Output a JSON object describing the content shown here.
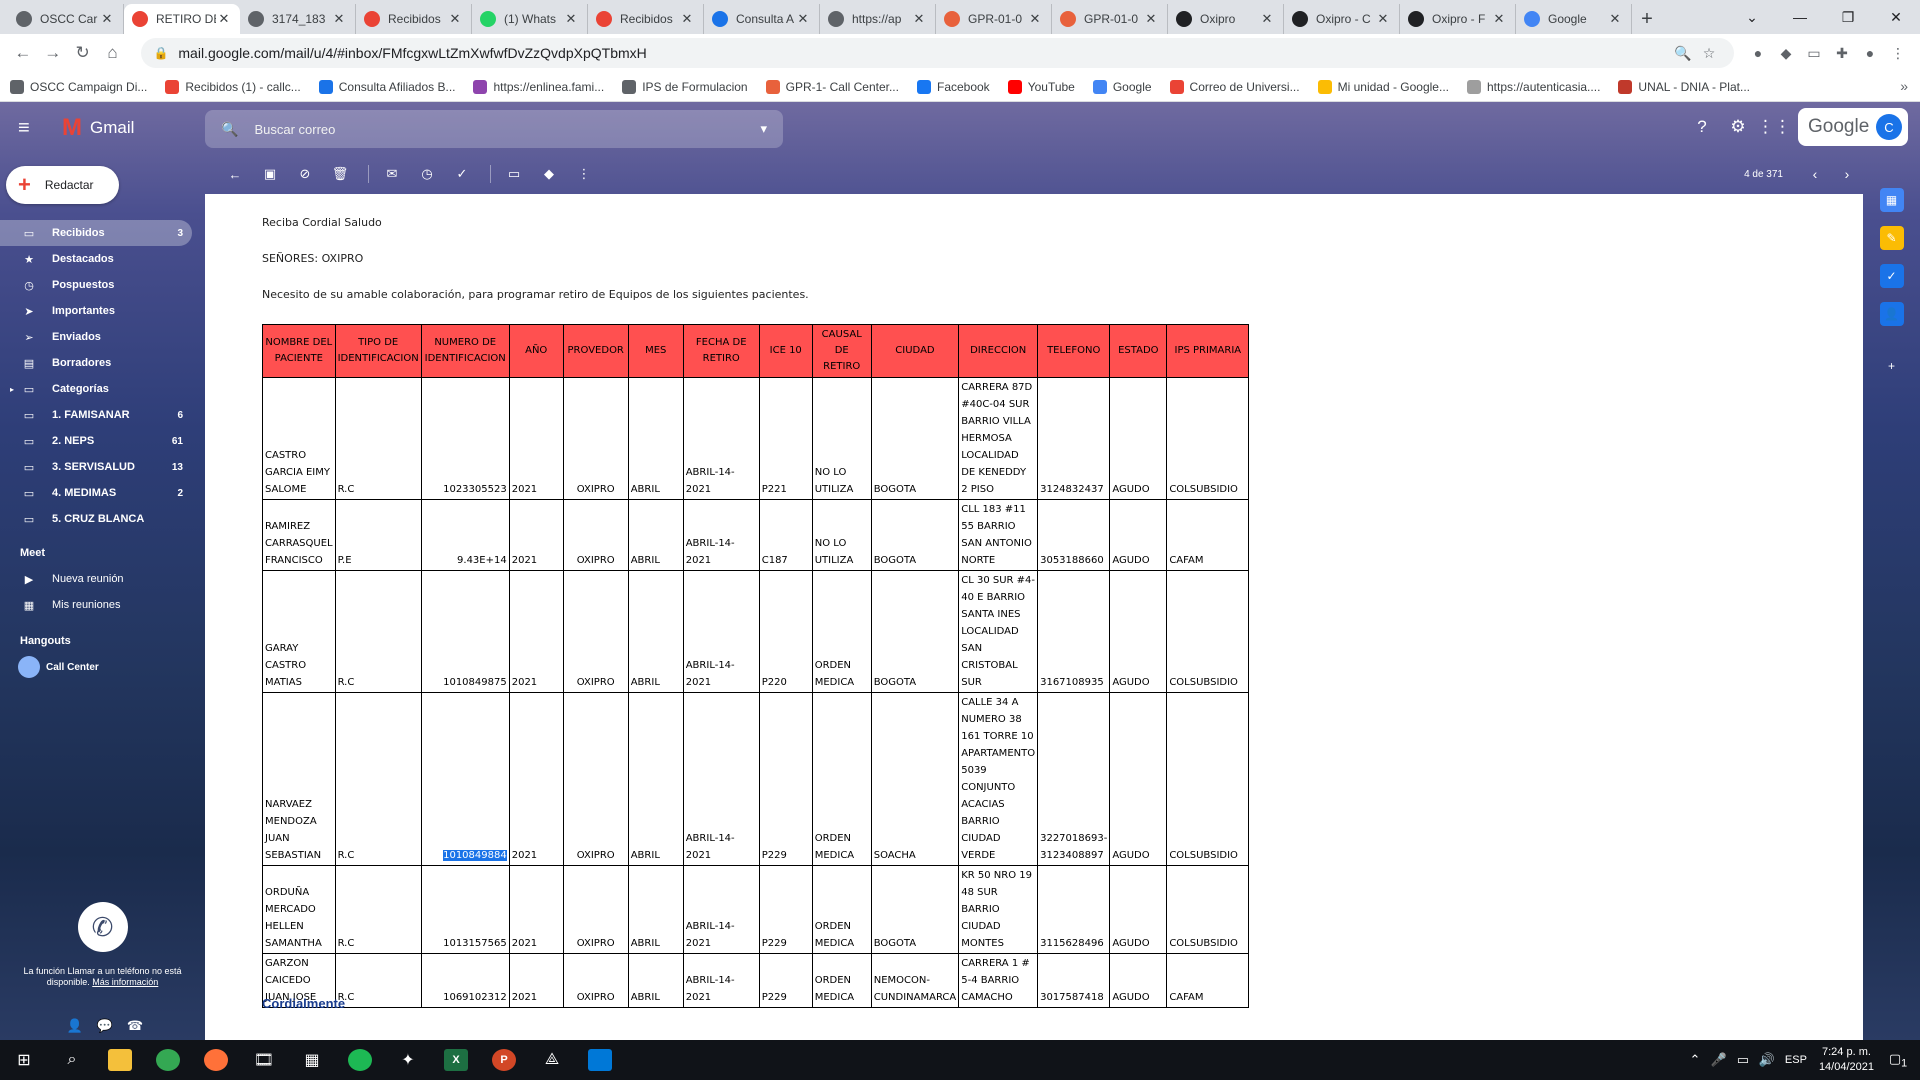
{
  "browser": {
    "tabs": [
      {
        "label": "OSCC Car",
        "color": "#5f6368"
      },
      {
        "label": "RETIRO DE",
        "color": "#ea4335",
        "active": true
      },
      {
        "label": "3174_183",
        "color": "#5f6368"
      },
      {
        "label": "Recibidos",
        "color": "#ea4335"
      },
      {
        "label": "(1) Whats",
        "color": "#25d366"
      },
      {
        "label": "Recibidos",
        "color": "#ea4335"
      },
      {
        "label": "Consulta A",
        "color": "#1a73e8"
      },
      {
        "label": "https://ap",
        "color": "#5f6368"
      },
      {
        "label": "GPR-01-0",
        "color": "#e8613c"
      },
      {
        "label": "GPR-01-0",
        "color": "#e8613c"
      },
      {
        "label": "Oxipro",
        "color": "#202124"
      },
      {
        "label": "Oxipro - C",
        "color": "#202124"
      },
      {
        "label": "Oxipro - F",
        "color": "#202124"
      },
      {
        "label": "Google",
        "color": "#4285f4"
      }
    ],
    "url": "mail.google.com/mail/u/4/#inbox/FMfcgxwLtZmXwfwfDvZzQvdpXpQTbmxH",
    "bookmarks": [
      {
        "label": "OSCC Campaign Di...",
        "color": "#5f6368"
      },
      {
        "label": "Recibidos (1) - callc...",
        "color": "#ea4335"
      },
      {
        "label": "Consulta Afiliados B...",
        "color": "#1a73e8"
      },
      {
        "label": "https://enlinea.fami...",
        "color": "#8e44ad"
      },
      {
        "label": "IPS de Formulacion",
        "color": "#5f6368"
      },
      {
        "label": "GPR-1- Call Center...",
        "color": "#e8613c"
      },
      {
        "label": "Facebook",
        "color": "#1877f2"
      },
      {
        "label": "YouTube",
        "color": "#ff0000"
      },
      {
        "label": "Google",
        "color": "#4285f4"
      },
      {
        "label": "Correo de Universi...",
        "color": "#ea4335"
      },
      {
        "label": "Mi unidad - Google...",
        "color": "#fbbc04"
      },
      {
        "label": "https://autenticasia....",
        "color": "#9e9e9e"
      },
      {
        "label": "UNAL - DNIA - Plat...",
        "color": "#c0392b"
      }
    ]
  },
  "gmail": {
    "brand": "Gmail",
    "search_placeholder": "Buscar correo",
    "google_label": "Google",
    "avatar_letter": "C",
    "compose_label": "Redactar",
    "nav": [
      {
        "label": "Recibidos",
        "count": "3",
        "icon": "inbox-icon",
        "glyph": "▭",
        "active": true
      },
      {
        "label": "Destacados",
        "count": "",
        "icon": "star-icon",
        "glyph": "★"
      },
      {
        "label": "Pospuestos",
        "count": "",
        "icon": "clock-icon",
        "glyph": "◷"
      },
      {
        "label": "Importantes",
        "count": "",
        "icon": "important-icon",
        "glyph": "➤"
      },
      {
        "label": "Enviados",
        "count": "",
        "icon": "send-icon",
        "glyph": "➢"
      },
      {
        "label": "Borradores",
        "count": "",
        "icon": "draft-icon",
        "glyph": "▤"
      },
      {
        "label": "Categorías",
        "count": "",
        "icon": "label-icon",
        "glyph": "▭",
        "caret": true
      },
      {
        "label": "1. FAMISANAR",
        "count": "6",
        "icon": "label-icon",
        "glyph": "▭"
      },
      {
        "label": "2. NEPS",
        "count": "61",
        "icon": "label-icon",
        "glyph": "▭"
      },
      {
        "label": "3. SERVISALUD",
        "count": "13",
        "icon": "label-icon",
        "glyph": "▭"
      },
      {
        "label": "4. MEDIMAS",
        "count": "2",
        "icon": "label-icon",
        "glyph": "▭"
      },
      {
        "label": "5. CRUZ BLANCA",
        "count": "",
        "icon": "label-icon",
        "glyph": "▭"
      }
    ],
    "meet_title": "Meet",
    "meet_items": [
      {
        "label": "Nueva reunión",
        "icon": "video-icon",
        "glyph": "▶"
      },
      {
        "label": "Mis reuniones",
        "icon": "calendar-icon",
        "glyph": "▦"
      }
    ],
    "hangouts_title": "Hangouts",
    "hangouts_user": "Call Center",
    "phone_msg": "La función Llamar a un teléfono no está disponible.",
    "phone_link": "Más información",
    "pager": "4 de 371"
  },
  "email": {
    "greeting": "Reciba Cordial Saludo",
    "to": "SEÑORES: OXIPRO",
    "request": "Necesito de su amable colaboración, para programar retiro de Equipos de los siguientes pacientes.",
    "closing": "Cordialmente",
    "headers": [
      "NOMBRE DEL PACIENTE",
      "TIPO DE IDENTIFICACION",
      "NUMERO DE IDENTIFICACION",
      "AÑO",
      "PROVEDOR",
      "MES",
      "FECHA DE RETIRO",
      "ICE 10",
      "CAUSAL DE RETIRO",
      "CIUDAD",
      "DIRECCION",
      "TELEFONO",
      "ESTADO",
      "IPS PRIMARIA"
    ],
    "rows": [
      [
        "CASTRO GARCIA EIMY SALOME",
        "R.C",
        "1023305523",
        "2021",
        "OXIPRO",
        "ABRIL",
        "ABRIL-14-2021",
        "P221",
        "NO LO UTILIZA",
        "BOGOTA",
        "CARRERA 87D #40C-04 SUR BARRIO VILLA HERMOSA LOCALIDAD DE KENEDDY 2 PISO",
        "3124832437",
        "AGUDO",
        "COLSUBSIDIO"
      ],
      [
        "RAMIREZ CARRASQUEL FRANCISCO",
        "P.E",
        "9.43E+14",
        "2021",
        "OXIPRO",
        "ABRIL",
        "ABRIL-14-2021",
        "C187",
        "NO LO UTILIZA",
        "BOGOTA",
        "CLL 183 #11 55 BARRIO SAN ANTONIO NORTE",
        "3053188660",
        "AGUDO",
        "CAFAM"
      ],
      [
        "GARAY CASTRO MATIAS",
        "R.C",
        "1010849875",
        "2021",
        "OXIPRO",
        "ABRIL",
        "ABRIL-14-2021",
        "P220",
        "ORDEN MEDICA",
        "BOGOTA",
        "CL 30 SUR #4-40 E BARRIO SANTA INES LOCALIDAD SAN CRISTOBAL SUR",
        "3167108935",
        "AGUDO",
        "COLSUBSIDIO"
      ],
      [
        "NARVAEZ MENDOZA JUAN SEBASTIAN",
        "R.C",
        "1010849884",
        "2021",
        "OXIPRO",
        "ABRIL",
        "ABRIL-14-2021",
        "P229",
        "ORDEN MEDICA",
        "SOACHA",
        "CALLE 34 A NUMERO 38 161 TORRE 10 APARTAMENTO 5039 CONJUNTO ACACIAS BARRIO CIUDAD VERDE",
        "3227018693-3123408897",
        "AGUDO",
        "COLSUBSIDIO"
      ],
      [
        "ORDUÑA MERCADO HELLEN SAMANTHA",
        "R.C",
        "1013157565",
        "2021",
        "OXIPRO",
        "ABRIL",
        "ABRIL-14-2021",
        "P229",
        "ORDEN MEDICA",
        "BOGOTA",
        "KR 50 NRO 19 48 SUR BARRIO CIUDAD MONTES",
        "3115628496",
        "AGUDO",
        "COLSUBSIDIO"
      ],
      [
        "GARZON CAICEDO JUAN JOSE",
        "R.C",
        "1069102312",
        "2021",
        "OXIPRO",
        "ABRIL",
        "ABRIL-14-2021",
        "P229",
        "ORDEN MEDICA",
        "NEMOCON-CUNDINAMARCA",
        "CARRERA 1 # 5-4 BARRIO CAMACHO",
        "3017587418",
        "AGUDO",
        "CAFAM"
      ]
    ]
  },
  "taskbar": {
    "lang": "ESP",
    "time": "7:24 p. m.",
    "date": "14/04/2021",
    "notif_count": "1"
  }
}
